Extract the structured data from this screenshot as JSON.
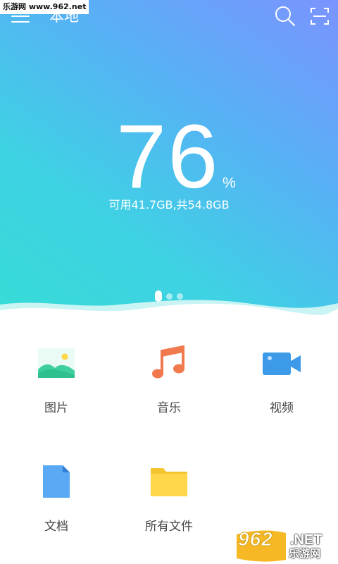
{
  "watermark_top": "乐游网 www.962.net",
  "header": {
    "title": "本地",
    "menu_icon": "hamburger-menu-icon",
    "search_icon": "search-icon",
    "scan_icon": "scan-frame-icon"
  },
  "storage": {
    "percent_value": "76",
    "percent_sign": "%",
    "summary": "可用41.7GB,共54.8GB",
    "used_fraction": 0.76
  },
  "pager": {
    "total": 3,
    "active_index": 0
  },
  "categories": [
    {
      "label": "图片",
      "icon": "image-icon",
      "color": "#3ecf9e"
    },
    {
      "label": "音乐",
      "icon": "music-note-icon",
      "color": "#f07a4e"
    },
    {
      "label": "视频",
      "icon": "video-camera-icon",
      "color": "#3d9ae8"
    },
    {
      "label": "文档",
      "icon": "document-icon",
      "color": "#5aa9f5"
    },
    {
      "label": "所有文件",
      "icon": "folder-icon",
      "color": "#ffd54a"
    }
  ],
  "watermark_bottom": {
    "logo": "962",
    "net": ".NET",
    "cn": "乐游网"
  },
  "colors": {
    "gradient_top": "#7b93ff",
    "gradient_bottom": "#36dcd6",
    "label_text": "#444444"
  }
}
